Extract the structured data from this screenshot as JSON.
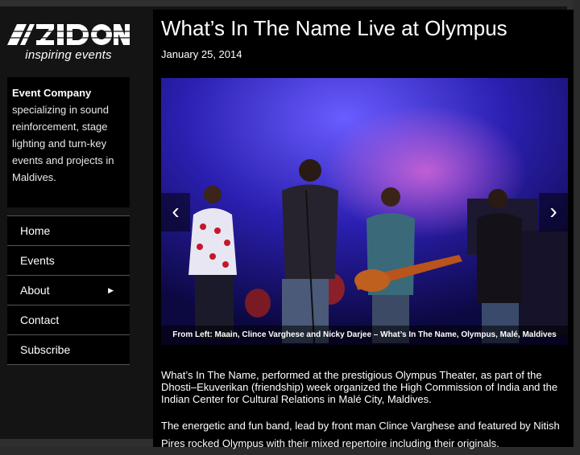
{
  "brand": {
    "logo_text": "AZIDON",
    "tagline": "inspiring events"
  },
  "about": {
    "heading": "Event Company",
    "text": "specializing in sound reinforcement, stage lighting and turn-key events and projects in Maldives."
  },
  "nav": {
    "items": [
      {
        "label": "Home"
      },
      {
        "label": "Events"
      },
      {
        "label": "About",
        "has_submenu": true,
        "arrow": "▶"
      },
      {
        "label": "Contact"
      },
      {
        "label": "Subscribe"
      }
    ]
  },
  "post": {
    "title": "What’s In The Name Live at Olympus",
    "date": "January 25, 2014",
    "caption": "From Left: Maain, Clince Varghese and Nicky Darjee – What’s In The Name, Olympus, Malé, Maldives",
    "prev_arrow": "‹",
    "next_arrow": "›",
    "paragraph1": "What’s In The Name, performed at the prestigious Olympus Theater, as part of the Dhosti–Ekuverikan (friendship) week organized the High Commission of India and the Indian Center for Cultural Relations in Malé City, Maldives.",
    "paragraph2": "The energetic and fun band, lead by front man Clince Varghese and featured by Nitish Pires rocked Olympus with their mixed repertoire including their originals."
  },
  "colors": {
    "page_bg": "#141414",
    "panel_bg": "#000000",
    "stage_blue": "#2a1fb0"
  }
}
